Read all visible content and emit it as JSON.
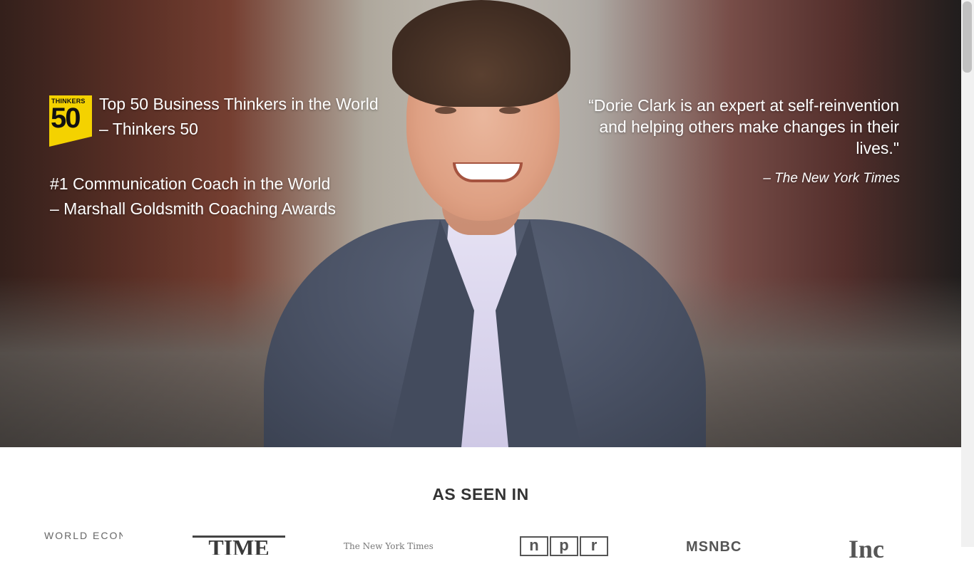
{
  "hero": {
    "thinkers_logo": {
      "top_text": "THINKERS",
      "number": "50",
      "color": "#f4d200"
    },
    "award1": {
      "line1": "Top 50 Business Thinkers in the World",
      "line2": "– Thinkers 50"
    },
    "award2": {
      "line1": "#1 Communication Coach in the World",
      "line2": "– Marshall Goldsmith Coaching Awards"
    },
    "quote": "“Dorie Clark is an expert at self-reinvention and helping others make changes in their lives.\"",
    "quote_source": "– The New York Times"
  },
  "as_seen_in": {
    "heading": "AS SEEN IN",
    "logos": {
      "wef": "WORLD ECONOMIC",
      "time": "TIME",
      "nyt": "The New York Times",
      "npr": [
        "n",
        "p",
        "r"
      ],
      "msnbc": "MSNBC",
      "inc": "Inc"
    }
  }
}
